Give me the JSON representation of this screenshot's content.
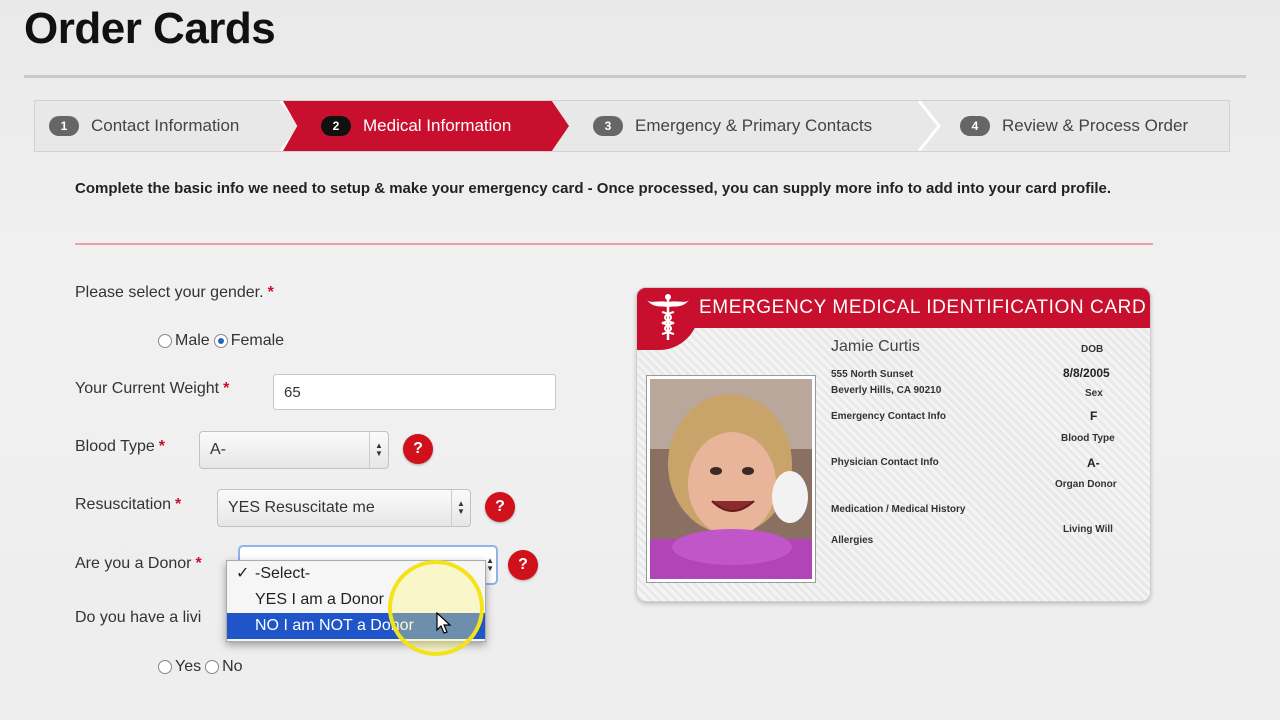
{
  "page": {
    "title": "Order Cards"
  },
  "steps": [
    {
      "num": "1",
      "label": "Contact Information",
      "active": false
    },
    {
      "num": "2",
      "label": "Medical Information",
      "active": true
    },
    {
      "num": "3",
      "label": "Emergency & Primary Contacts",
      "active": false
    },
    {
      "num": "4",
      "label": "Review & Process Order",
      "active": false
    }
  ],
  "intro": "Complete the basic info we need to setup & make your emergency card - Once processed, you can supply more info to add into your card profile.",
  "form": {
    "required_mark": "*",
    "gender": {
      "label": "Please select your gender.",
      "options": [
        "Male",
        "Female"
      ],
      "selected": "Female"
    },
    "weight": {
      "label": "Your Current Weight",
      "value": "65"
    },
    "blood_type": {
      "label": "Blood Type",
      "value": "A-"
    },
    "resuscitation": {
      "label": "Resuscitation",
      "value": "YES Resuscitate me"
    },
    "donor": {
      "label": "Are you a Donor",
      "options": [
        "-Select-",
        "YES I am a Donor",
        "NO I am NOT a Donor"
      ],
      "checked": "-Select-",
      "highlighted": "NO I am NOT a Donor"
    },
    "living_will": {
      "label": "Do you have a livi",
      "options": [
        "Yes",
        "No"
      ]
    },
    "help_glyph": "?"
  },
  "card": {
    "header": "EMERGENCY MEDICAL IDENTIFICATION CARD",
    "name": "Jamie Curtis",
    "address_line1": "555 North Sunset",
    "address_line2": "Beverly Hills, CA 90210",
    "emergency_label": "Emergency Contact Info",
    "physician_label": "Physician Contact Info",
    "medication_label": "Medication / Medical History",
    "allergies_label": "Allergies",
    "dob_label": "DOB",
    "dob_value": "8/8/2005",
    "sex_label": "Sex",
    "sex_value": "F",
    "blood_label": "Blood Type",
    "blood_value": "A-",
    "organ_label": "Organ Donor",
    "living_will_label": "Living Will"
  },
  "colors": {
    "brand_red": "#c8102e",
    "selection_blue": "#1f55c9"
  },
  "icons": {
    "card_logo": "caduceus-icon",
    "cursor": "mouse-pointer-icon"
  }
}
